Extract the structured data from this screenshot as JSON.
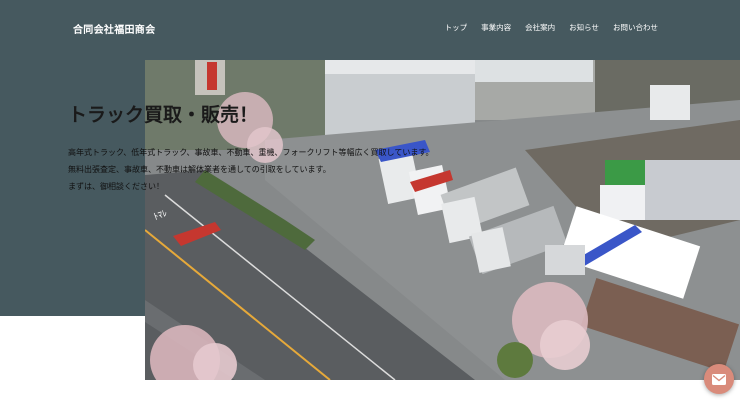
{
  "header": {
    "brand": "合同会社福田商会",
    "nav": [
      {
        "label": "トップ"
      },
      {
        "label": "事業内容"
      },
      {
        "label": "会社案内"
      },
      {
        "label": "お知らせ"
      },
      {
        "label": "お問い合わせ"
      }
    ]
  },
  "hero": {
    "title": "トラック買取・販売！",
    "lines": [
      "高年式トラック、低年式トラック、事故車、不動車、重機、フォークリフト等幅広く買取しています。",
      "無料出張査定、事故車、不動車は解体業者を通しての引取をしています。",
      "まずは、御相談ください！"
    ],
    "image_icon": "aerial-truck-yard-photo"
  },
  "contact_button": {
    "icon": "mail-icon"
  },
  "colors": {
    "header_bg": "#46595f",
    "header_text": "#ffffff",
    "fab_bg": "#d98b7b"
  }
}
